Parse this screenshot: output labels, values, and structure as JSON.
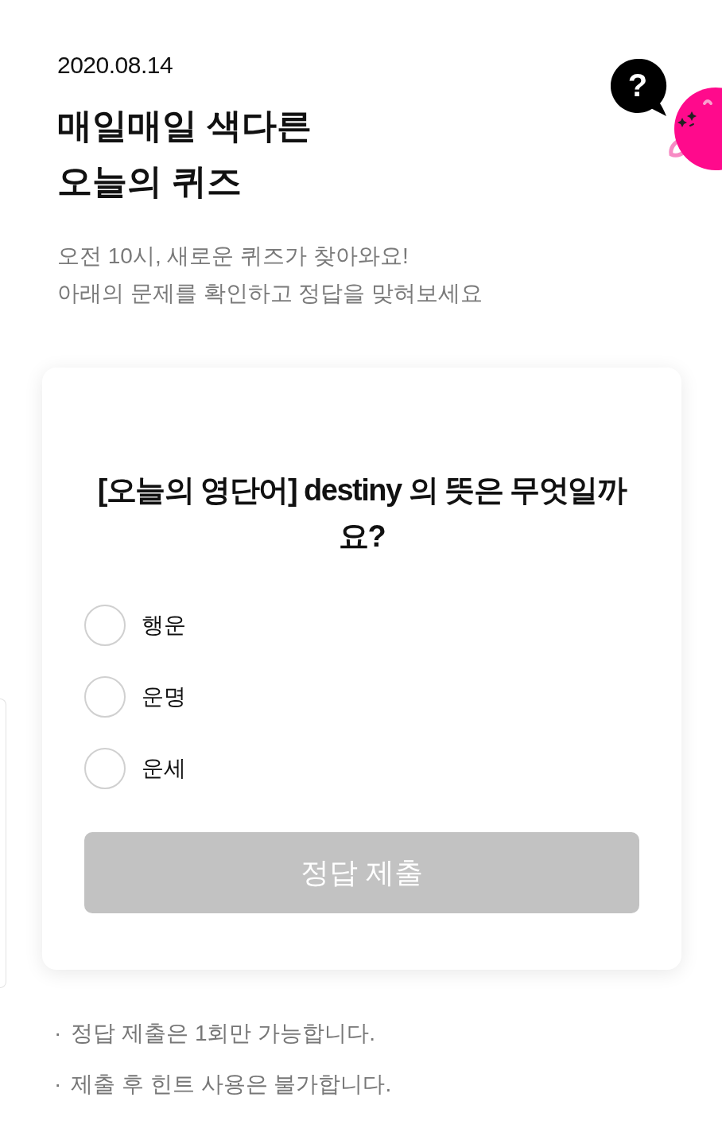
{
  "header": {
    "date": "2020.08.14",
    "title_lines": [
      "매일매일 색다른",
      "오늘의 퀴즈"
    ],
    "subtitle_lines": [
      "오전 10시, 새로운 퀴즈가 찾아와요!",
      "아래의 문제를 확인하고 정답을 맞혀보세요"
    ]
  },
  "mascot": {
    "bubble_text": "?"
  },
  "quiz": {
    "question": "[오늘의 영단어] destiny 의 뜻은 무엇일까요?",
    "options": [
      {
        "label": "행운",
        "selected": false
      },
      {
        "label": "운명",
        "selected": false
      },
      {
        "label": "운세",
        "selected": false
      }
    ],
    "submit_button": {
      "label": "정답 제출",
      "disabled": true
    }
  },
  "notes": [
    {
      "marker": "·",
      "text": "정답 제출은 1회만 가능합니다."
    },
    {
      "marker": "·",
      "text": "제출 후 힌트 사용은 불가합니다."
    }
  ]
}
